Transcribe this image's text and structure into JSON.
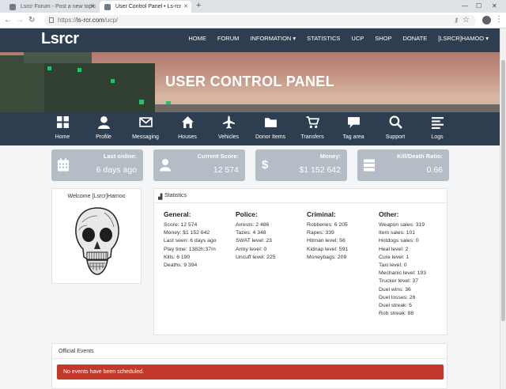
{
  "browser": {
    "tabs": [
      {
        "label": "Lsrcr Forum - Post a new topic"
      },
      {
        "label": "User Control Panel • Ls-rcr"
      }
    ],
    "url_prefix": "https://",
    "url_host": "ls-rcr.com",
    "url_path": "/ucp/"
  },
  "site": {
    "logo": "Lsrcr",
    "nav": [
      "HOME",
      "FORUM",
      "INFORMATION ▾",
      "STATISTICS",
      "UCP",
      "SHOP",
      "DONATE",
      "[LSRCR]HAMOO ▾"
    ],
    "banner_title": "USER CONTROL PANEL"
  },
  "iconnav": [
    {
      "label": "Home",
      "icon": "grid-icon"
    },
    {
      "label": "Profile",
      "icon": "user-icon"
    },
    {
      "label": "Messaging",
      "icon": "envelope-icon"
    },
    {
      "label": "Houses",
      "icon": "house-icon"
    },
    {
      "label": "Vehicles",
      "icon": "plane-icon"
    },
    {
      "label": "Donor Items",
      "icon": "folder-icon"
    },
    {
      "label": "Transfers",
      "icon": "cart-icon"
    },
    {
      "label": "Tag area",
      "icon": "comment-icon"
    },
    {
      "label": "Support",
      "icon": "search-icon"
    },
    {
      "label": "Logs",
      "icon": "list-icon"
    }
  ],
  "cards": [
    {
      "title": "Last online:",
      "value": "6 days ago",
      "icon": "calendar-icon"
    },
    {
      "title": "Current Score:",
      "value": "12 574",
      "icon": "user-icon"
    },
    {
      "title": "Money:",
      "value": "$1 152 642",
      "icon": "dollar-icon"
    },
    {
      "title": "Kill/Death Ratio:",
      "value": "0.66",
      "icon": "server-icon"
    }
  ],
  "welcome": {
    "title": "Welcome [Lsrcr]Hamoo"
  },
  "statistics": {
    "title": "Statistics",
    "columns": [
      {
        "heading": "General:",
        "rows": [
          "Score: 12 574",
          "Money: $1 152 642",
          "Last seen: 6 days ago",
          "Play time: 1382h:37m",
          "Kills: 6 190",
          "Deaths: 9 394"
        ]
      },
      {
        "heading": "Police:",
        "rows": [
          "Arrests: 2 486",
          "Tazes: 4 348",
          "SWAT level: 23",
          "Army level: 0",
          "Uncuff level: 225"
        ]
      },
      {
        "heading": "Criminal:",
        "rows": [
          "Robberies: 6 205",
          "Rapes: 339",
          "Hitman level: 56",
          "Kidnap level: 591",
          "Moneybags: 209"
        ]
      },
      {
        "heading": "Other:",
        "rows": [
          "Weapon sales: 319",
          "Item sales: 101",
          "Hotdogs sales: 0",
          "Heal level: 2",
          "Cure level: 1",
          "Taxi level: 0",
          "Mechanic level: 193",
          "Trucker level: 37",
          "Duel wins: 36",
          "Duel losses: 26",
          "Duel streak: 5",
          "Rob streak: 88"
        ]
      }
    ]
  },
  "events": {
    "title": "Official Events",
    "alert": "No events have been scheduled."
  }
}
